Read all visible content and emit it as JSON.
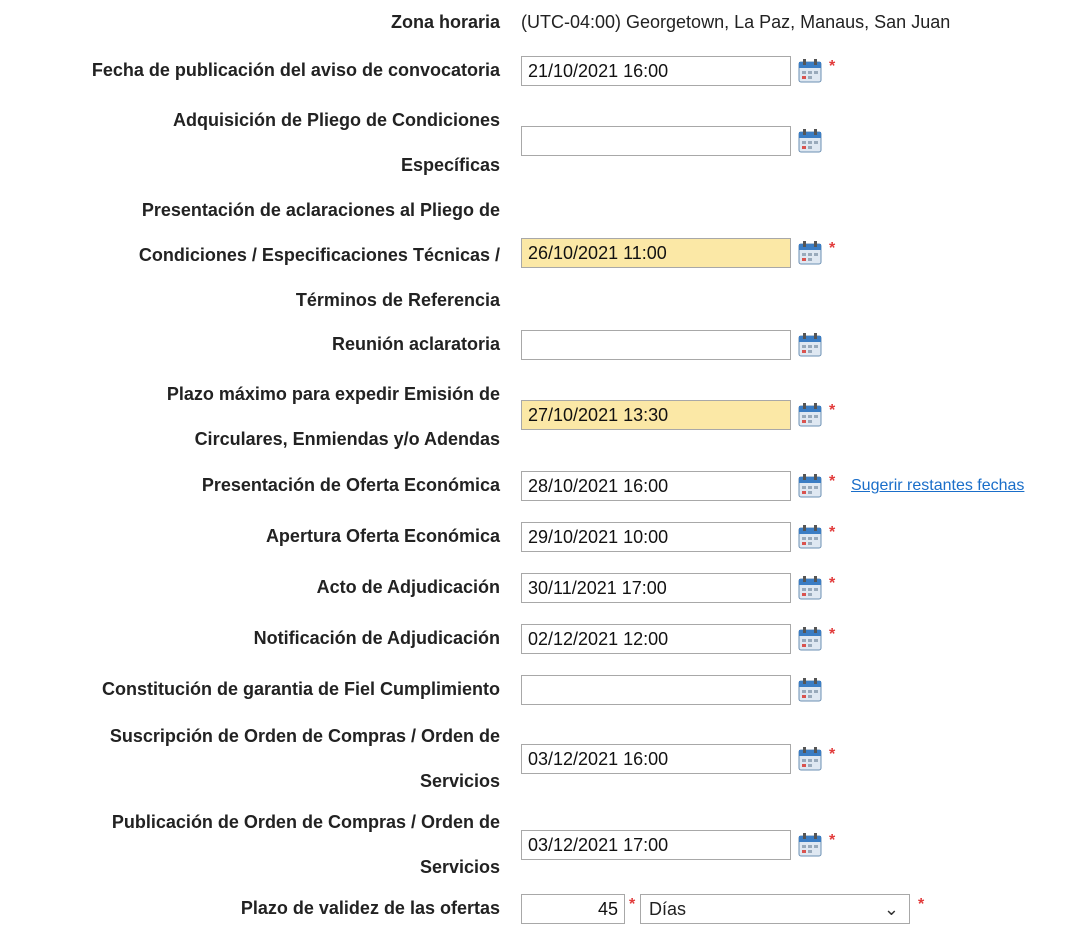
{
  "timezone": {
    "label": "Zona horaria",
    "value": "(UTC-04:00) Georgetown, La Paz, Manaus, San Juan"
  },
  "rows": [
    {
      "label": [
        "Fecha de publicación del aviso de convocatoria"
      ],
      "value": "21/10/2021 16:00",
      "required": "*"
    },
    {
      "label": [
        "Adquisición de Pliego de Condiciones",
        "Específicas"
      ],
      "value": "",
      "required": ""
    },
    {
      "label": [
        "Presentación de aclaraciones al Pliego de",
        "Condiciones / Especificaciones Técnicas /",
        "Términos de Referencia"
      ],
      "value": "26/10/2021 11:00",
      "required": "*"
    },
    {
      "label": [
        "Reunión aclaratoria"
      ],
      "value": "",
      "required": ""
    },
    {
      "label": [
        "Plazo máximo para expedir Emisión de",
        "Circulares, Enmiendas y/o Adendas"
      ],
      "value": "27/10/2021 13:30",
      "required": "*"
    },
    {
      "label": [
        "Presentación de Oferta Económica"
      ],
      "value": "28/10/2021 16:00",
      "required": "*",
      "link": "Sugerir restantes fechas"
    },
    {
      "label": [
        "Apertura Oferta Económica"
      ],
      "value": "29/10/2021 10:00",
      "required": "*"
    },
    {
      "label": [
        "Acto de Adjudicación"
      ],
      "value": "30/11/2021 17:00",
      "required": "*"
    },
    {
      "label": [
        "Notificación de Adjudicación"
      ],
      "value": "02/12/2021 12:00",
      "required": "*"
    },
    {
      "label": [
        "Constitución de garantia de Fiel Cumplimiento"
      ],
      "value": "",
      "required": ""
    },
    {
      "label": [
        "Suscripción de Orden de Compras / Orden de",
        "Servicios"
      ],
      "value": "03/12/2021 16:00",
      "required": "*"
    },
    {
      "label": [
        "Publicación de Orden de Compras / Orden de",
        "Servicios"
      ],
      "value": "03/12/2021 17:00",
      "required": "*"
    }
  ],
  "validity": {
    "label": "Plazo de validez de las ofertas",
    "value": "45",
    "required": "*",
    "unit": "Días",
    "unit_required": "*"
  },
  "icons": {
    "calendar": "calendar-icon",
    "dropdown": "chevron-down-icon"
  },
  "colors": {
    "highlight": "#fbe8a6",
    "required": "#e23b3b",
    "link": "#1a6ec9"
  }
}
